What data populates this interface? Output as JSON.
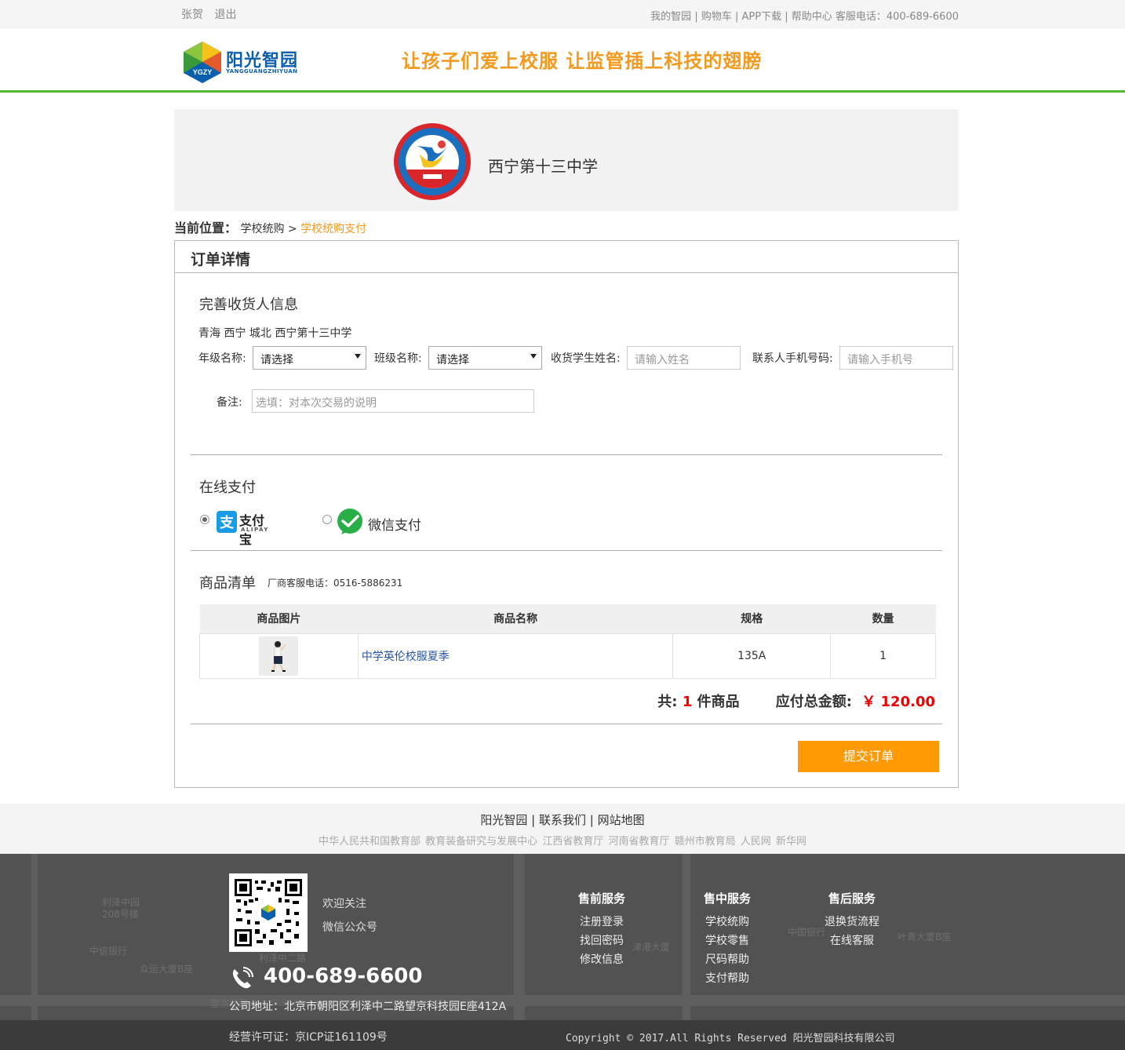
{
  "topbar": {
    "user": "张贺",
    "logout": "退出",
    "my_yard": "我的智园",
    "cart": "购物车",
    "app": "APP下载",
    "help": "帮助中心",
    "hotline": "客服电话：400-689-6600"
  },
  "header": {
    "logo_cn": "阳光智园",
    "logo_en": "YANGGUANGZHIYUAN",
    "logo_badge": "YGZY",
    "slogan": "让孩子们爱上校服  让监管插上科技的翅膀"
  },
  "school": {
    "name": "西宁第十三中学"
  },
  "breadcrumb": {
    "label": "当前位置：",
    "parent": "学校统购",
    "separator": ">",
    "current": "学校统购支付"
  },
  "order": {
    "title": "订单详情",
    "receiver_title": "完善收货人信息",
    "address": "青海 西宁 城北 西宁第十三中学",
    "grade_label": "年级名称:",
    "grade_value": "请选择",
    "class_label": "班级名称:",
    "class_value": "请选择",
    "student_label": "收货学生姓名:",
    "student_placeholder": "请输入姓名",
    "phone_label": "联系人手机号码:",
    "phone_placeholder": "请输入手机号",
    "remark_label": "备注:",
    "remark_placeholder": "选填：对本次交易的说明",
    "payment_title": "在线支付",
    "alipay_cn": "支付宝",
    "alipay_en": "ALIPAY",
    "wechat": "微信支付",
    "goods_title": "商品清单",
    "service_phone": "厂商客服电话：0516-5886231",
    "columns": [
      "商品图片",
      "商品名称",
      "规格",
      "数量"
    ],
    "items": [
      {
        "name": "中学英伦校服夏季",
        "spec": "135A",
        "qty": "1"
      }
    ],
    "total_prefix": "共:",
    "total_count": "1",
    "total_suffix": "件商品",
    "amount_label": "应付总金额:",
    "amount": "￥ 120.00",
    "submit": "提交订单"
  },
  "links": {
    "main": [
      "阳光智园",
      "联系我们",
      "网站地图"
    ],
    "friends": [
      "中华人民共和国教育部",
      "教育装备研究与发展中心",
      "江西省教育厅",
      "河南省教育厅",
      "赣州市教育局",
      "人民网",
      "新华网"
    ]
  },
  "footer": {
    "follow1": "欢迎关注",
    "follow2": "微信公众号",
    "presale_title": "售前服务",
    "presale": [
      "注册登录",
      "找回密码",
      "修改信息"
    ],
    "onsale_title": "售中服务",
    "onsale": [
      "学校统购",
      "学校零售",
      "尺码帮助",
      "支付帮助"
    ],
    "aftersale_title": "售后服务",
    "aftersale": [
      "退换货流程",
      "在线客服"
    ],
    "phone": "400-689-6600",
    "address": "公司地址：北京市朝阳区利泽中二路望京科技园E座412A",
    "icp": "经营许可证：京ICP证161109号",
    "copyright": "Copyright © 2017.All Rights Reserved 阳光智园科技有限公司",
    "map_labels": [
      "利泽中园",
      "208号楼",
      "众运大厦B座",
      "中信银行",
      "望京北路",
      "津港大厦",
      "叶青大厦B座",
      "中国银行",
      "利泽中二路"
    ]
  },
  "colors": {
    "accent_green": "#5cb531",
    "accent_orange": "#ff9a05",
    "price_red": "#e00000",
    "link_blue": "#2255aa"
  }
}
